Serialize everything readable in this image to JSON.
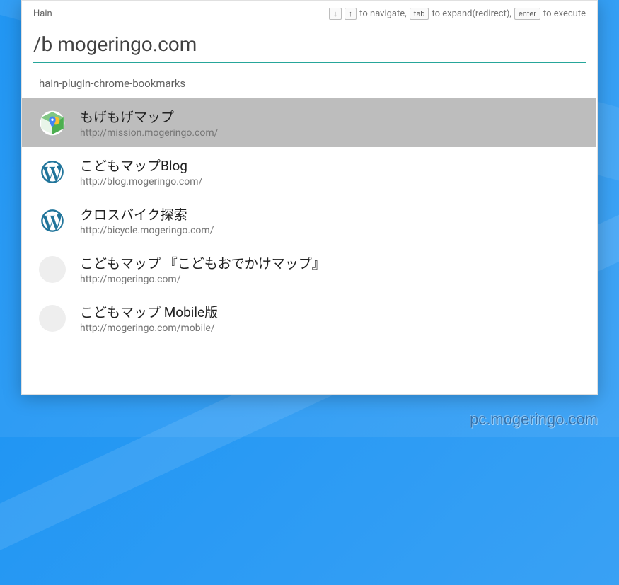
{
  "app": {
    "title": "Hain"
  },
  "hints": {
    "nav": "to navigate,",
    "tab": "tab",
    "expand": "to expand(redirect),",
    "enter": "enter",
    "execute": "to execute"
  },
  "search": {
    "value": "/b mogeringo.com"
  },
  "section": {
    "label": "hain-plugin-chrome-bookmarks"
  },
  "results": [
    {
      "title": "もげもげマップ",
      "url": "http://mission.mogeringo.com/",
      "icon": "maps",
      "selected": true
    },
    {
      "title": "こどもマップBlog",
      "url": "http://blog.mogeringo.com/",
      "icon": "wordpress",
      "selected": false
    },
    {
      "title": "クロスバイク探索",
      "url": "http://bicycle.mogeringo.com/",
      "icon": "wordpress",
      "selected": false
    },
    {
      "title": "こどもマップ 『こどもおでかけマップ』",
      "url": "http://mogeringo.com/",
      "icon": "blank",
      "selected": false
    },
    {
      "title": "こどもマップ Mobile版",
      "url": "http://mogeringo.com/mobile/",
      "icon": "blank",
      "selected": false
    }
  ],
  "watermark": "pc.mogeringo.com"
}
